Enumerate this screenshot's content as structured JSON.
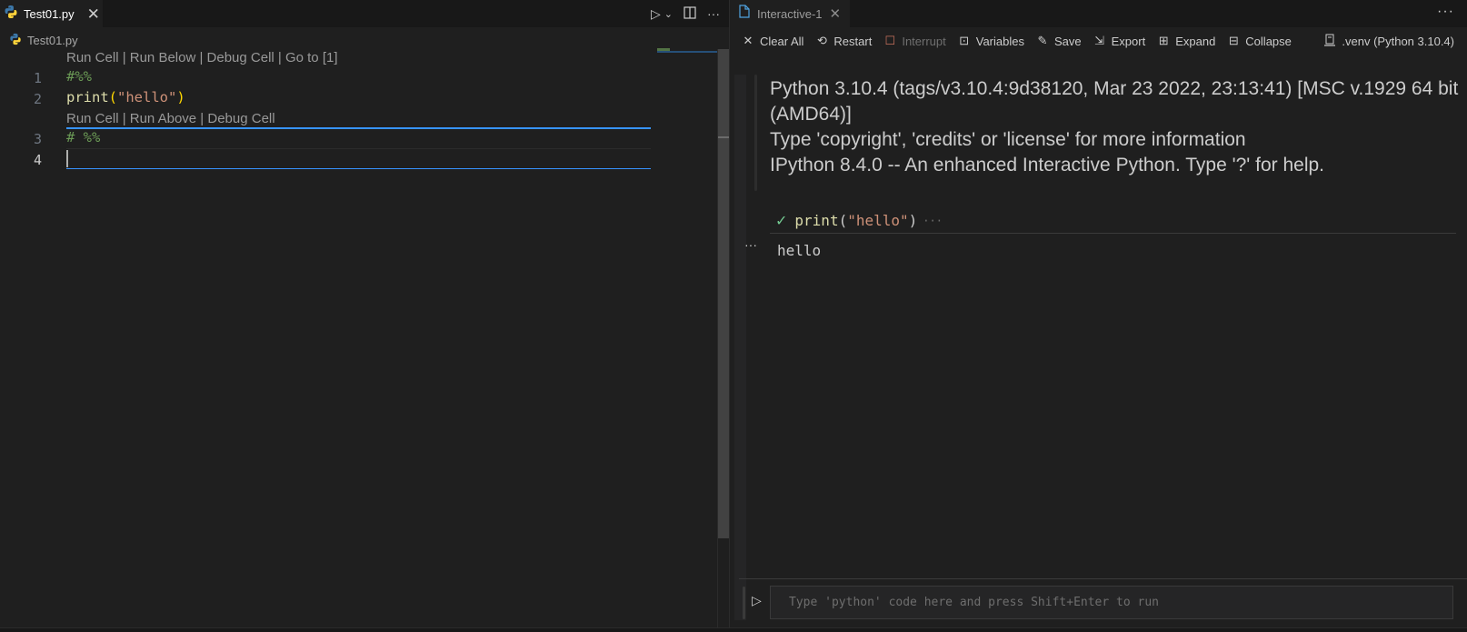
{
  "editor": {
    "tab": {
      "label": "Test01.py",
      "icon": "python-icon",
      "close": "✕"
    },
    "actions": {
      "run": "▷",
      "run_dropdown": "⌄",
      "split": "split-editor-icon",
      "more": "···"
    },
    "breadcrumb": {
      "label": "Test01.py",
      "icon": "python-icon"
    },
    "codelens_1": "Run Cell | Run Below | Debug Cell | Go to [1]",
    "codelens_2": "Run Cell | Run Above | Debug Cell",
    "lines": [
      {
        "number": "1",
        "text": "#%%"
      },
      {
        "number": "2",
        "fn": "print",
        "open": "(",
        "str": "\"hello\"",
        "close": ")"
      },
      {
        "number": "3",
        "text": "# %%"
      },
      {
        "number": "4",
        "text": ""
      }
    ]
  },
  "interactive": {
    "tab": {
      "label": "Interactive-1",
      "icon": "file-icon",
      "close": "✕"
    },
    "more": "···",
    "toolbar": [
      {
        "icon": "✕",
        "label": "Clear All"
      },
      {
        "icon": "⟲",
        "label": "Restart"
      },
      {
        "icon": "☐",
        "label": "Interrupt"
      },
      {
        "icon": "⊡",
        "label": "Variables"
      },
      {
        "icon": "✎",
        "label": "Save"
      },
      {
        "icon": "⇲",
        "label": "Export"
      },
      {
        "icon": "⊞",
        "label": "Expand"
      },
      {
        "icon": "⊟",
        "label": "Collapse"
      }
    ],
    "kernel": {
      "icon": "🖥",
      "label": ".venv (Python 3.10.4)"
    },
    "banner": [
      "Python 3.10.4 (tags/v3.10.4:9d38120, Mar 23 2022, 23:13:41) [MSC v.1929 64 bit (AMD64)]",
      "Type 'copyright', 'credits' or 'license' for more information",
      "IPython 8.4.0 -- An enhanced Interactive Python. Type '?' for help."
    ],
    "cell": {
      "status": "✓",
      "fn": "print",
      "open": "(",
      "str": "\"hello\"",
      "close": ")",
      "more": "···"
    },
    "output_more": "···",
    "output": "hello",
    "input": {
      "run": "▷",
      "placeholder": "Type 'python' code here and press Shift+Enter to run"
    }
  }
}
